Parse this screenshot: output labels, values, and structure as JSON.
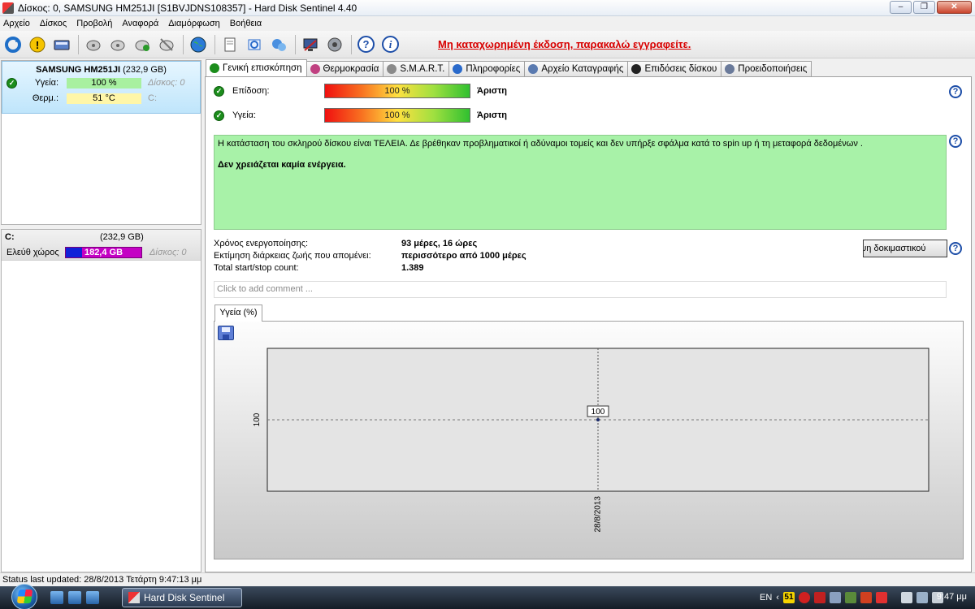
{
  "window": {
    "title": "Δίσκος: 0, SAMSUNG HM251JI [S1BVJDNS108357]  -  Hard Disk Sentinel 4.40",
    "min": "‒",
    "max": "❐",
    "close": "✕"
  },
  "menu": [
    "Αρχείο",
    "Δίσκος",
    "Προβολή",
    "Αναφορά",
    "Διαμόρφωση",
    "Βοήθεια"
  ],
  "toolbar": {
    "registration_link": "Μη καταχωρημένη έκδοση, παρακαλώ εγγραφείτε.",
    "help_glyph": "?",
    "info_glyph": "i"
  },
  "disk": {
    "name": "SAMSUNG HM251JI",
    "size": "(232,9 GB)",
    "health_label": "Υγεία:",
    "health_value": "100 %",
    "health_aux": "Δίσκος: 0",
    "temp_label": "Θερμ.:",
    "temp_value": "51 °C",
    "temp_aux": "C:"
  },
  "partition": {
    "letter": "C:",
    "size": "(232,9 GB)",
    "free_label": "Ελεύθ χώρος",
    "free_value": "182,4 GB",
    "disk_ref": "Δίσκος: 0"
  },
  "tabs": [
    {
      "label": "Γενική επισκόπηση",
      "color": "#1c8d1c"
    },
    {
      "label": "Θερμοκρασία",
      "color": "#c04080"
    },
    {
      "label": "S.M.A.R.T.",
      "color": "#8a8a8a"
    },
    {
      "label": "Πληροφορίες",
      "color": "#2a6acb"
    },
    {
      "label": "Αρχείο Καταγραφής",
      "color": "#5a7ab0"
    },
    {
      "label": "Επιδόσεις δίσκου",
      "color": "#222222"
    },
    {
      "label": "Προειδοποιήσεις",
      "color": "#6a7a9a"
    }
  ],
  "overview": {
    "performance_label": "Επίδοση:",
    "performance_value": "100 %",
    "performance_result": "Άριστη",
    "health_label": "Υγεία:",
    "health_value": "100 %",
    "health_result": "Άριστη",
    "status_text": "Η κατάσταση του σκληρού δίσκου είναι ΤΕΛΕΙΑ. Δε βρέθηκαν προβληματικοί ή αδύναμοι τομείς και δεν υπήρξε σφάλμα κατά το spin up ή τη μεταφορά δεδομένων .",
    "recommendation": "Δεν χρειάζεται καμία ενέργεια.",
    "info": [
      {
        "label": "Χρόνος ενεργοποίησης:",
        "value": "93 μέρες, 16 ώρες"
      },
      {
        "label": "Εκτίμηση διάρκειας ζωής που απομένει:",
        "value": "περισσότερο από 1000 μέρες"
      },
      {
        "label": "Total start/stop count:",
        "value": "1.389"
      }
    ],
    "test_button": "Λήψη δοκιμαστικού",
    "comment_placeholder": "Click to add comment ...",
    "help_glyph": "?"
  },
  "chart_tab": "Υγεία (%)",
  "chart_data": {
    "type": "line",
    "x": [
      "28/8/2013"
    ],
    "series": [
      {
        "values": [
          100
        ]
      }
    ],
    "title": "",
    "xlabel": "",
    "ylabel": "",
    "y_tick_labels": [
      "100"
    ],
    "data_labels": [
      "100"
    ],
    "grid": true
  },
  "status_bar": "Status last updated: 28/8/2013 Τετάρτη 9:47:13 μμ",
  "taskbar": {
    "app": "Hard Disk Sentinel",
    "lang": "EN",
    "tray_temp": "51",
    "clock": "9:47 μμ"
  },
  "colors": {
    "status_green": "#a8f2a8",
    "registration_red": "#d80000",
    "selected_disk": "#bfe5fb"
  }
}
